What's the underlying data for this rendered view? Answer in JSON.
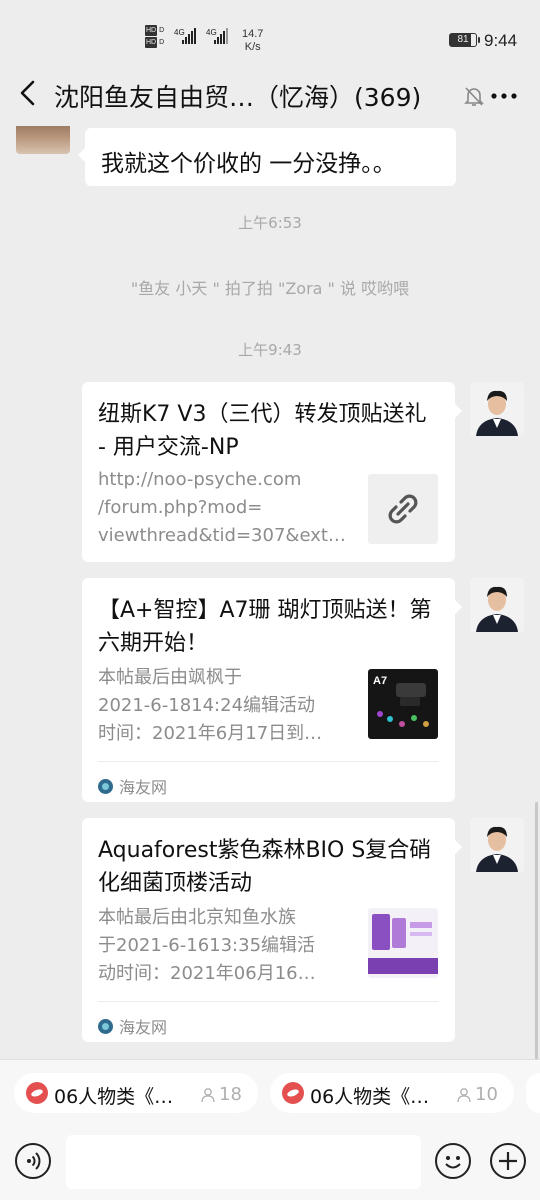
{
  "status_bar": {
    "network_a": "4G",
    "network_b": "4G",
    "speed_value": "14.7",
    "speed_unit": "K/s",
    "battery": "81",
    "time": "9:44"
  },
  "nav": {
    "title": "沈阳鱼友自由贸…（忆海）(369)"
  },
  "messages": {
    "top_bubble": "我就这个价收的  一分没挣。。",
    "time_1": "上午6:53",
    "pat": "\"鱼友 小天 \" 拍了拍 \"Zora \" 说 哎哟喂",
    "time_2": "上午9:43",
    "card1": {
      "title": "纽斯K7 V3（三代）转发顶贴送礼 - 用户交流-NP",
      "desc": [
        "http://noo-psyche.com",
        "/forum.php?mod=",
        "viewthread&tid=307&extr…"
      ]
    },
    "card2": {
      "title": "【A+智控】A7珊 瑚灯顶贴送！第六期开始！",
      "desc": [
        "本帖最后由飒枫于",
        "2021-6-1814:24编辑活动",
        "时间：2021年6月17日到…"
      ],
      "thumb_label": "A7",
      "source": "海友网"
    },
    "card3": {
      "title": "Aquaforest紫色森林BIO S复合硝化细菌顶楼活动",
      "desc": [
        "本帖最后由北京知鱼水族",
        "于2021-6-1613:35编辑活",
        "动时间：2021年06月16…"
      ],
      "source": "海友网"
    }
  },
  "bottom": {
    "chips": [
      {
        "label": "06人物类《…",
        "count": "18"
      },
      {
        "label": "06人物类《…",
        "count": "10"
      }
    ]
  },
  "colors": {
    "background": "#ededed",
    "bubble": "#ffffff",
    "chip_icon": "#e4504f",
    "muted_text": "#a8a8a8"
  }
}
